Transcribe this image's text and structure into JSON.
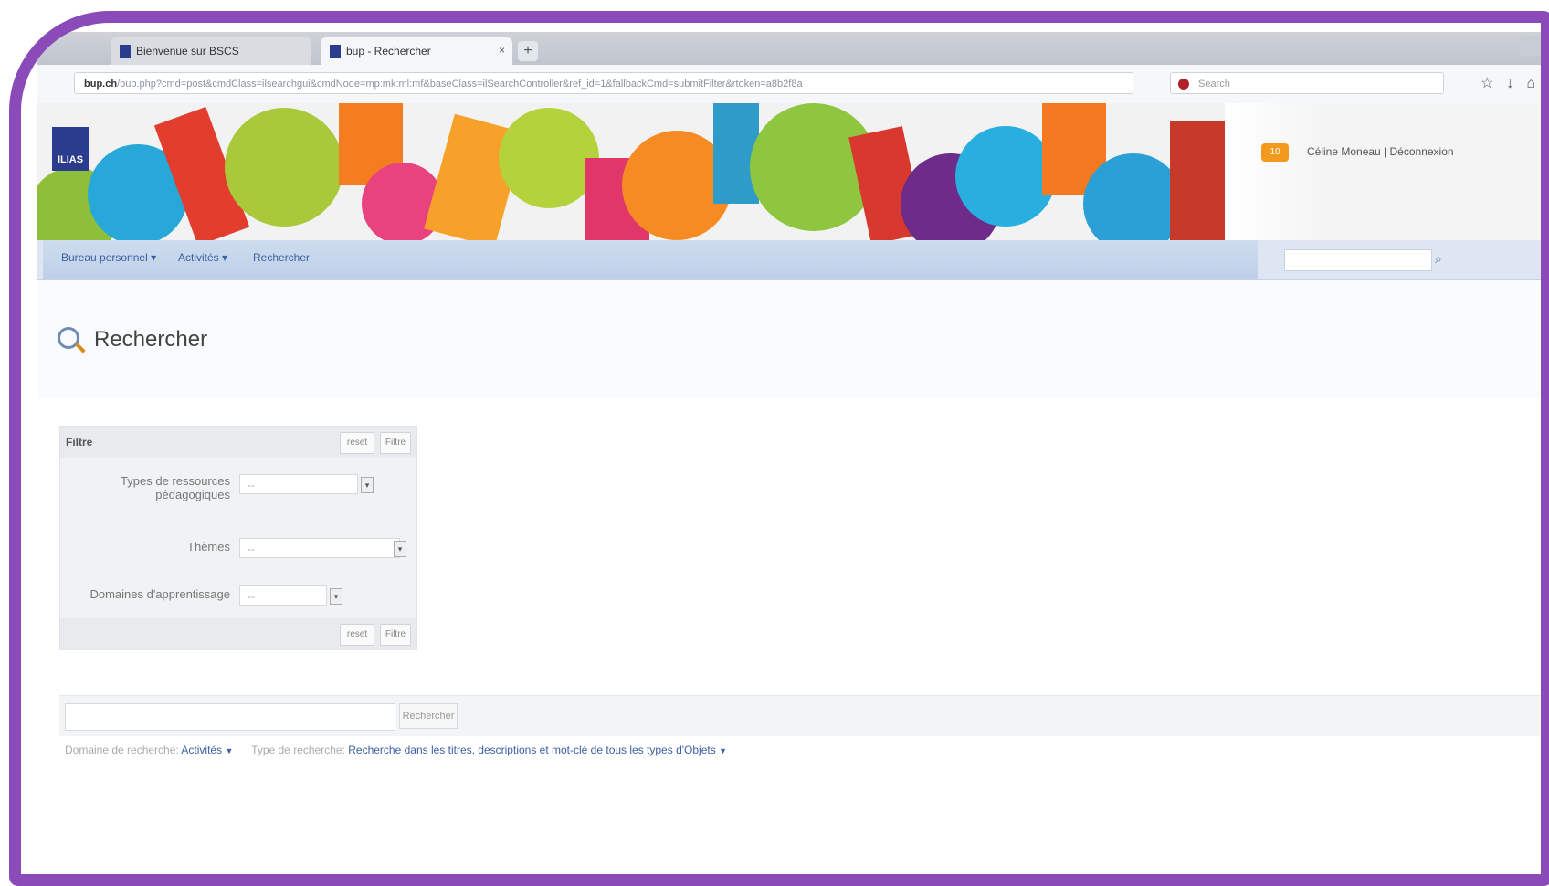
{
  "browser": {
    "tabs": [
      {
        "label": "Bienvenue sur BSCS",
        "active": false
      },
      {
        "label": "bup - Rechercher",
        "active": true
      }
    ],
    "new_tab_label": "+",
    "url_host": "bup.ch",
    "url_rest": "/bup.php?cmd=post&cmdClass=ilsearchgui&cmdNode=mp:mk:ml:mf&baseClass=ilSearchController&ref_id=1&fallbackCmd=submitFilter&rtoken=a8b2f8a",
    "search_placeholder": "Search"
  },
  "banner": {
    "logo_text": "ILIAS",
    "message_count": "10",
    "user_label": "Céline Moneau | Déconnexion"
  },
  "menu": {
    "items": [
      {
        "label": "Bureau personnel ▾"
      },
      {
        "label": "Activités ▾"
      },
      {
        "label": "Rechercher"
      }
    ]
  },
  "page": {
    "title": "Rechercher",
    "filter": {
      "title": "Filtre",
      "reset_label": "reset",
      "apply_label": "Filtre",
      "fields": [
        {
          "label_line1": "Types de ressources",
          "label_line2": "pédagogiques",
          "value": "--"
        },
        {
          "label_line1": "Thèmes",
          "label_line2": "",
          "value": "--"
        },
        {
          "label_line1": "Domaines d'apprentissage",
          "label_line2": "",
          "value": "--"
        }
      ]
    },
    "search": {
      "input_value": "",
      "button_label": "Rechercher"
    },
    "scope": {
      "area_label": "Domaine de recherche:",
      "area_value": "Activités",
      "type_label": "Type de recherche:",
      "type_value": "Recherche dans les titres, descriptions et mot-clé de tous les types d'Objets"
    }
  },
  "colors": {
    "frame": "#8a4bb8",
    "menu_blue": "#bdd0e8",
    "link_blue": "#3a5fa3"
  }
}
